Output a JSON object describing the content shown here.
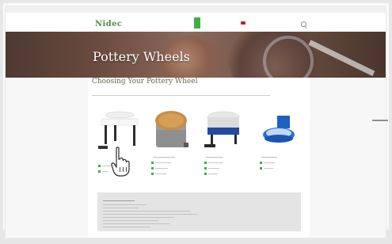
{
  "page": {
    "logo": "Nidec",
    "hero_title": "Pottery Wheels",
    "heading": "Choosing Your Pottery Wheel"
  },
  "colors": {
    "brand_green": "#3fae49",
    "hero_brown": "#6a4b3e",
    "info_box": "#e4e4e4"
  },
  "icons": {
    "cursor": "hand-pointer-icon",
    "search": "search-icon",
    "flag": "flag-icon"
  }
}
